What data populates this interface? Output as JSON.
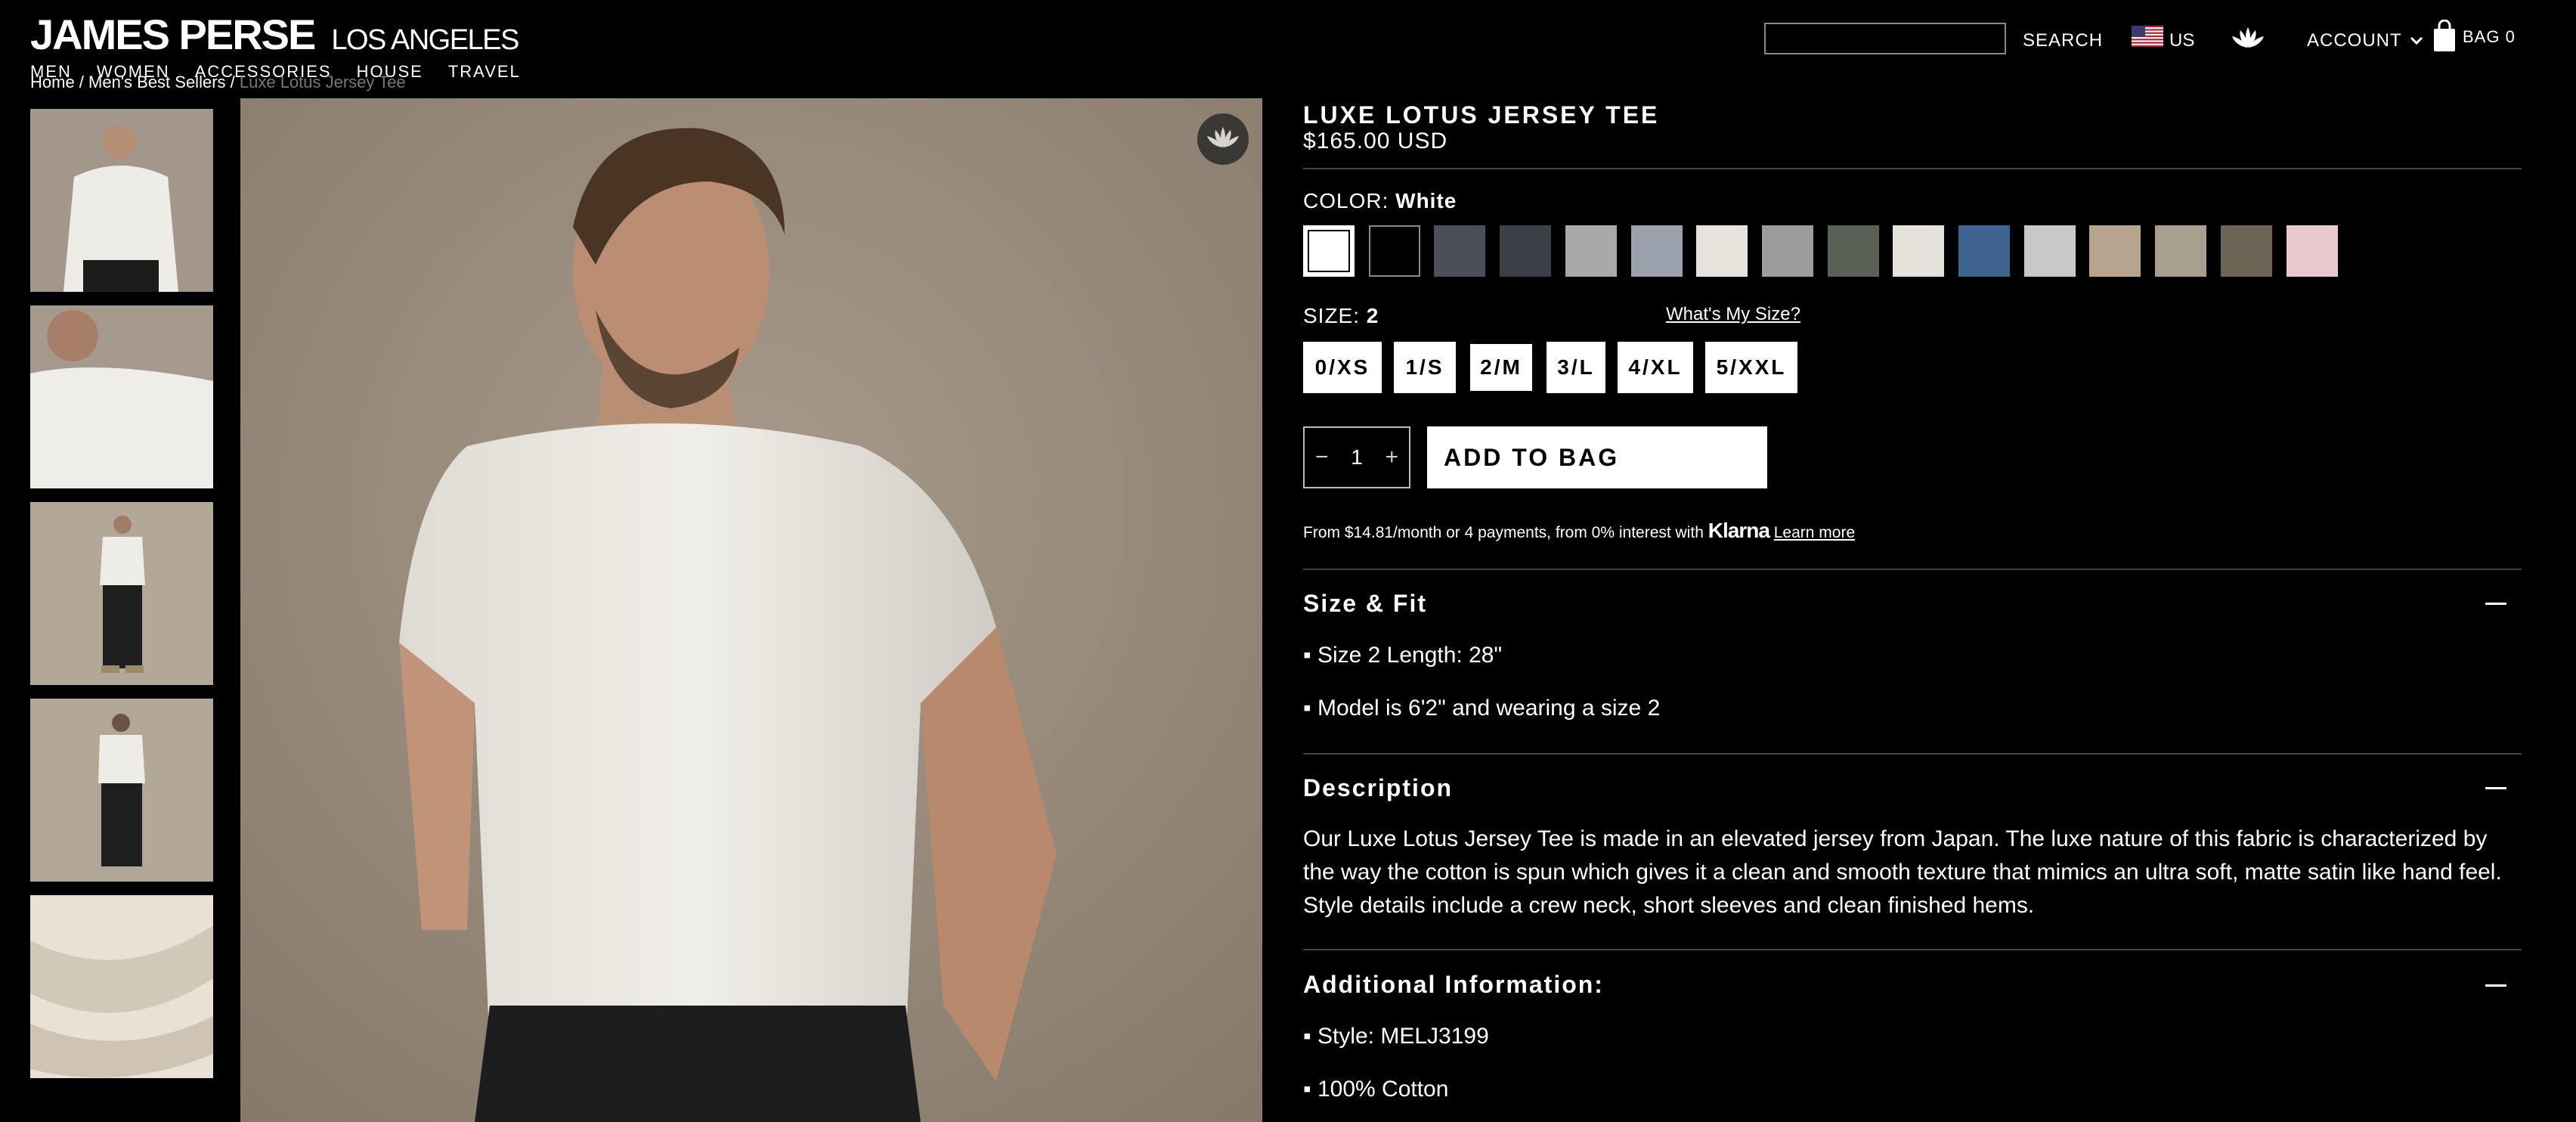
{
  "header": {
    "brand": "JAMES PERSE",
    "brand_sub": "LOS ANGELES",
    "nav": [
      "MEN",
      "WOMEN",
      "ACCESSORIES",
      "HOUSE",
      "TRAVEL"
    ],
    "search_label": "SEARCH",
    "search_value": "",
    "country": "US",
    "account_label": "ACCOUNT",
    "bag_label": "BAG 0"
  },
  "breadcrumb": [
    "Home",
    "Men's Best Sellers",
    "Luxe Lotus Jersey Tee"
  ],
  "product": {
    "title": "LUXE LOTUS JERSEY TEE",
    "price": "$165.00 USD",
    "color_label": "COLOR:",
    "color_value": "White",
    "swatches": [
      "#ffffff",
      "#000000",
      "#4b4f57",
      "#3b3f46",
      "#a8a9ab",
      "#9aa2ad",
      "#e6e3dc",
      "#9b9b9b",
      "#5a6258",
      "#e4e1da",
      "#3e6591",
      "#c7c8c9",
      "#b7a48f",
      "#a89f8f",
      "#6d6456",
      "#e9c9cf"
    ],
    "size_label": "SIZE:",
    "size_value": "2",
    "size_guide": "What's My Size?",
    "sizes": [
      "0/XS",
      "1/S",
      "2/M",
      "3/L",
      "4/XL",
      "5/XXL"
    ],
    "quantity": "1",
    "add_to_bag": "ADD TO BAG",
    "klarna_text": "From $14.81/month or 4 payments, from 0% interest with",
    "klarna_brand": "Klarna",
    "klarna_link": "Learn more"
  },
  "sections": {
    "size_fit": {
      "title": "Size & Fit",
      "items": [
        "▪ Size 2 Length: 28\"",
        "▪ Model is 6'2\" and wearing a size 2"
      ]
    },
    "description": {
      "title": "Description",
      "text": "Our Luxe Lotus Jersey Tee is made in an elevated jersey from Japan. The luxe nature of this fabric is characterized by the way the cotton is spun which gives it a clean and smooth texture that mimics an ultra soft, matte satin like hand feel. Style details include a crew neck, short sleeves and clean finished hems."
    },
    "additional": {
      "title": "Additional Information:",
      "items": [
        "▪ Style: MELJ3199",
        "▪ 100% Cotton"
      ]
    }
  }
}
